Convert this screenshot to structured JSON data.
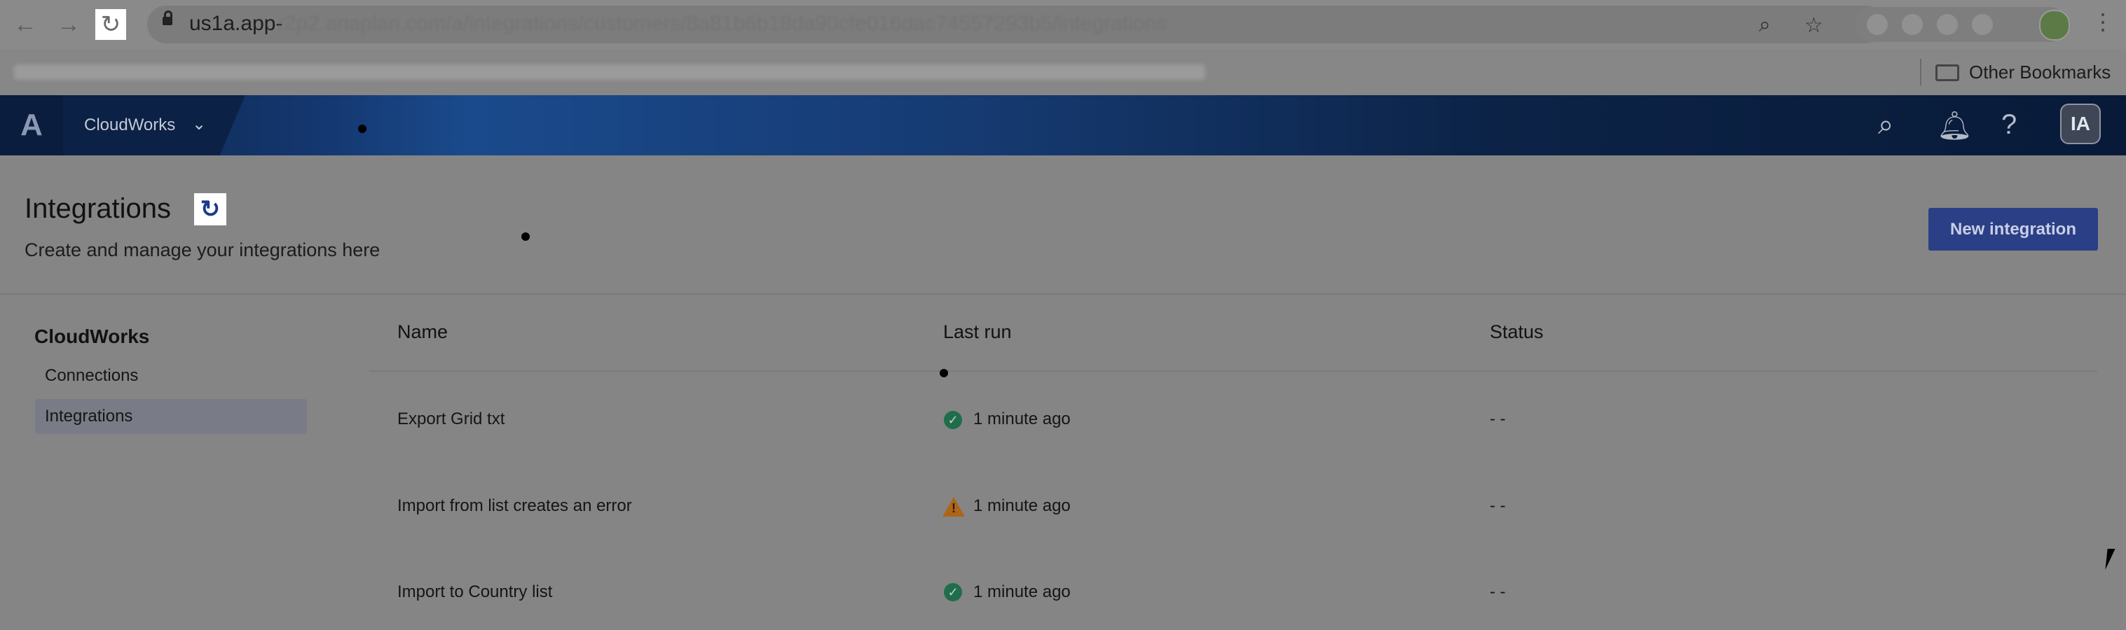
{
  "browser": {
    "url_visible": "us1a.app-",
    "url_rest": "r2p2.anaplan.com/a/integrations/customers/8a81b6b18da90cfe016dac74557293b5/integrations",
    "other_bookmarks": "Other Bookmarks"
  },
  "header": {
    "app_switcher_label": "CloudWorks",
    "avatar_initials": "IA",
    "logo": "A"
  },
  "page": {
    "title": "Integrations",
    "subtitle": "Create and manage your integrations here",
    "new_button": "New integration"
  },
  "sidebar": {
    "heading": "CloudWorks",
    "items": [
      {
        "label": "Connections",
        "active": false
      },
      {
        "label": "Integrations",
        "active": true
      }
    ]
  },
  "table": {
    "columns": [
      "Name",
      "Last run",
      "Status"
    ],
    "rows": [
      {
        "name": "Export Grid txt",
        "last_run": "1 minute ago",
        "run_status": "success",
        "status": "- -"
      },
      {
        "name": "Import from list creates an error",
        "last_run": "1 minute ago",
        "run_status": "warning",
        "status": "- -"
      },
      {
        "name": "Import to Country list",
        "last_run": "1 minute ago",
        "run_status": "success",
        "status": "- -"
      }
    ]
  },
  "icons": {
    "back": "back-arrow-icon",
    "forward": "forward-arrow-icon",
    "reload": "reload-icon",
    "refresh": "refresh-icon",
    "search": "search-icon",
    "bell": "bell-icon",
    "help": "help-icon"
  },
  "colors": {
    "header_dark": "#0c2347",
    "header_mid": "#1a4a8c",
    "primary_button": "#2b3f86",
    "success": "#1f6d4b",
    "warning": "#ad6518",
    "overlay_bg": "#858585"
  }
}
